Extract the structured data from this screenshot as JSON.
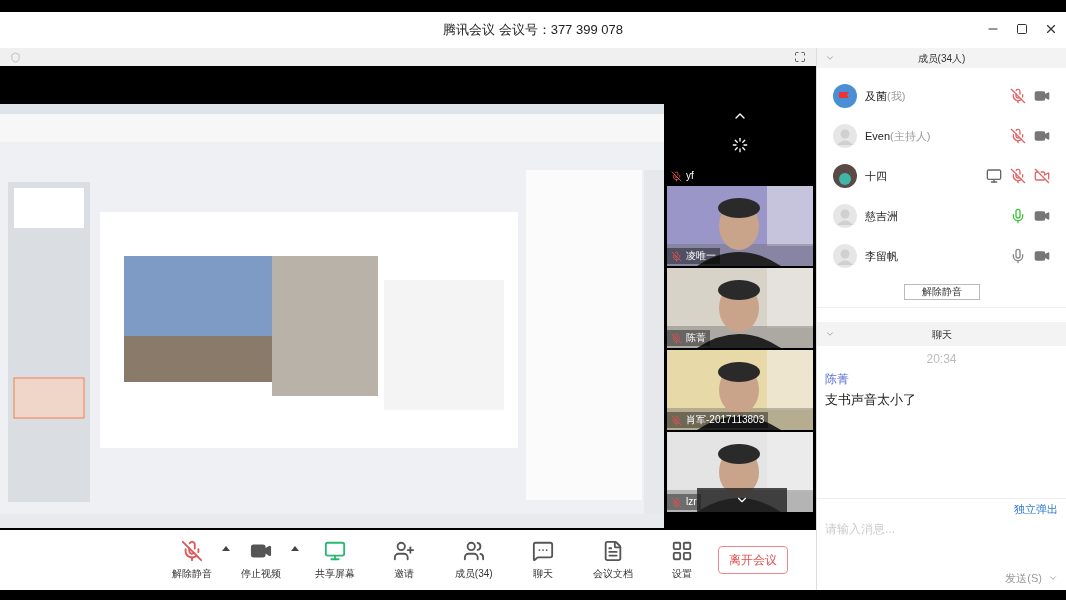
{
  "window": {
    "title": "腾讯会议 会议号：377 399 078"
  },
  "video_tiles": [
    {
      "name": "yf",
      "kind": "label_only"
    },
    {
      "name": "凌唯一",
      "kind": "person"
    },
    {
      "name": "陈菁",
      "kind": "person"
    },
    {
      "name": "肖军-2017113803",
      "kind": "person"
    },
    {
      "name": "lzr",
      "kind": "person"
    }
  ],
  "members_panel": {
    "title": "成员(34人)",
    "members": [
      {
        "name": "及菌",
        "role": "(我)",
        "kind": "flag",
        "muted": true,
        "camera_off": false,
        "sharing": false
      },
      {
        "name": "Even",
        "role": "(主持人)",
        "kind": "blank",
        "muted": true,
        "camera_off": false,
        "sharing": false
      },
      {
        "name": "十四",
        "muted": true,
        "camera_off": true,
        "sharing": true
      },
      {
        "name": "慈吉洲",
        "kind": "blank",
        "muted": false,
        "speaking": true,
        "camera_off": false,
        "sharing": false
      },
      {
        "name": "李留帆",
        "kind": "blank",
        "muted": false,
        "speaking": false,
        "camera_off": false,
        "sharing": false
      }
    ],
    "button": "解除静音"
  },
  "chat_panel": {
    "title": "聊天",
    "messages": [
      {
        "time": "20:34",
        "sender": "陈菁",
        "text": "支书声音太小了"
      }
    ],
    "popout_link": "独立弹出",
    "input": {
      "placeholder": "请输入消息..."
    },
    "send_button": "发送(S)"
  },
  "toolbar": [
    {
      "kind": "mic",
      "label": "解除静音",
      "caret": true
    },
    {
      "kind": "video",
      "label": "停止视频",
      "caret": true
    },
    {
      "kind": "share",
      "label": "共享屏幕",
      "caret": false
    },
    {
      "kind": "invite",
      "label": "邀请",
      "caret": false
    },
    {
      "kind": "members",
      "label": "成员(34)",
      "caret": false
    },
    {
      "kind": "chat",
      "label": "聊天",
      "caret": false
    },
    {
      "kind": "docs",
      "label": "会议文档",
      "caret": false
    },
    {
      "kind": "settings",
      "label": "设置",
      "caret": false
    }
  ],
  "leave_button": "离开会议"
}
